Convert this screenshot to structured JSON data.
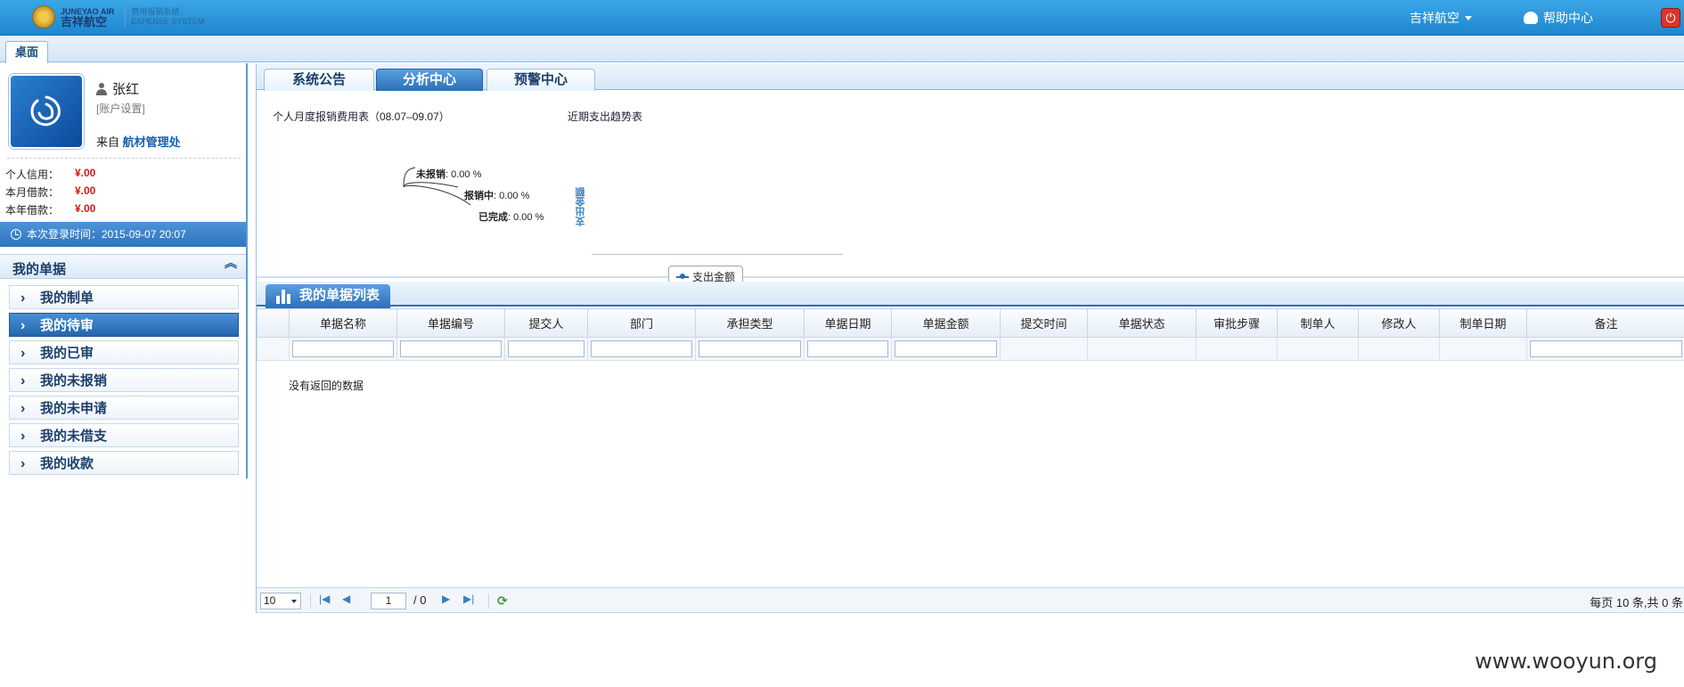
{
  "header": {
    "logo_en": "JUNEYAO AIR",
    "logo_cn": "吉祥航空",
    "system_name": "费用报销系统",
    "system_name_en": "EXPENSE SYSTEM",
    "company": "吉祥航空",
    "help": "帮助中心",
    "accent": "#1f86cf"
  },
  "tabs": {
    "desktop": "桌面"
  },
  "user": {
    "name": "张红",
    "account_settings": "[账户设置]",
    "from_label": "来自",
    "department": "航材管理处",
    "credit_label": "个人信用：",
    "credit_value": "¥.00",
    "month_loan_label": "本月借款：",
    "month_loan_value": "¥.00",
    "year_loan_label": "本年借款：",
    "year_loan_value": "¥.00",
    "last_login": "本次登录时间：2015-09-07 20:07"
  },
  "sidebar": {
    "title": "我的单据",
    "items": [
      {
        "label": "我的制单"
      },
      {
        "label": "我的待审"
      },
      {
        "label": "我的已审"
      },
      {
        "label": "我的未报销"
      },
      {
        "label": "我的未申请"
      },
      {
        "label": "我的未借支"
      },
      {
        "label": "我的收款"
      }
    ],
    "active_index": 1
  },
  "main": {
    "sub_tabs": [
      "系统公告",
      "分析中心",
      "预警中心"
    ],
    "active_sub_tab": 1,
    "pie_title": "个人月度报销费用表（08.07–09.07）",
    "trend_title": "近期支出趋势表",
    "pie": [
      {
        "label": "未报销",
        "value": "0.00 %"
      },
      {
        "label": "报销中",
        "value": "0.00 %"
      },
      {
        "label": "已完成",
        "value": "0.00 %"
      }
    ],
    "trend_y_label": "支出金额",
    "trend_legend": "支出金额",
    "list_title": "我的单据列表",
    "columns": [
      "单据名称",
      "单据编号",
      "提交人",
      "部门",
      "承担类型",
      "单据日期",
      "单据金额",
      "提交时间",
      "单据状态",
      "审批步骤",
      "制单人",
      "修改人",
      "制单日期",
      "备注"
    ],
    "no_data": "没有返回的数据",
    "pager": {
      "page_size": "10",
      "current_page": "1",
      "total_pages": "/ 0",
      "info": "每页 10 条,共 0 条"
    }
  },
  "watermark": "www.wooyun.org"
}
